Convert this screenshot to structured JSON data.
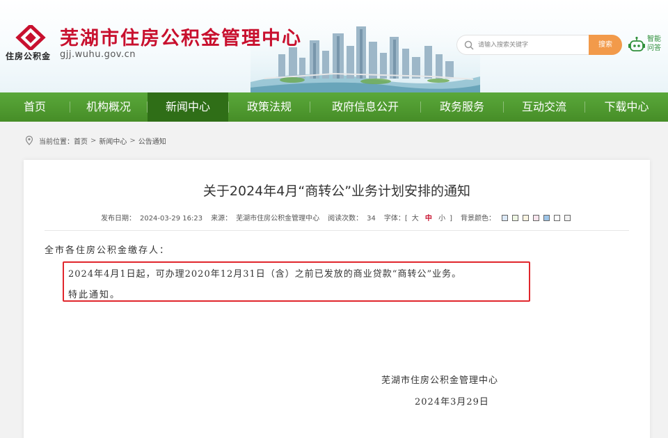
{
  "header": {
    "site_title": "芜湖市住房公积金管理中心",
    "logo_caption": "住房公积金",
    "domain": "gjj.wuhu.gov.cn",
    "search_placeholder": "请输入搜索关键字",
    "search_button": "搜索",
    "assistant_label": "智能问答",
    "brand_color": "#c8102e",
    "logo_icon": "housing-fund-diamond-logo"
  },
  "nav": {
    "items": [
      {
        "label": "首页"
      },
      {
        "label": "机构概况"
      },
      {
        "label": "新闻中心",
        "active": true
      },
      {
        "label": "政策法规"
      },
      {
        "label": "政府信息公开"
      },
      {
        "label": "政务服务"
      },
      {
        "label": "互动交流"
      },
      {
        "label": "下载中心"
      }
    ],
    "color": "#4f9a2f",
    "active_color": "#2f6e17"
  },
  "breadcrumb": {
    "prefix": "当前位置：",
    "items": [
      "首页",
      "新闻中心",
      "公告通知"
    ],
    "separator": ">"
  },
  "article": {
    "title": "关于2024年4月“商转公”业务计划安排的通知",
    "meta": {
      "date_label": "发布日期：",
      "date": "2024-03-29 16:23",
      "source_label": "来源：",
      "source": "芜湖市住房公积金管理中心",
      "views_label": "阅读次数：",
      "views": "34",
      "font_label": "字体：[",
      "font_large": "大",
      "font_medium": "中",
      "font_small": "小",
      "font_close": "]",
      "bg_label": "背景颜色："
    },
    "bg_swatches": [
      "#dce9f7",
      "#eef6e3",
      "#faf4e1",
      "#f7e4ec",
      "#9ec5e8",
      "#ffffff",
      "#f2f2f2"
    ],
    "salutation": "全市各住房公积金缴存人：",
    "body_line1": "2024年4月1日起，可办理2020年12月31日（含）之前已发放的商业贷款“商转公”业务。",
    "body_line2": "特此通知。",
    "signature": "芜湖市住房公积金管理中心",
    "sign_date": "2024年3月29日"
  }
}
